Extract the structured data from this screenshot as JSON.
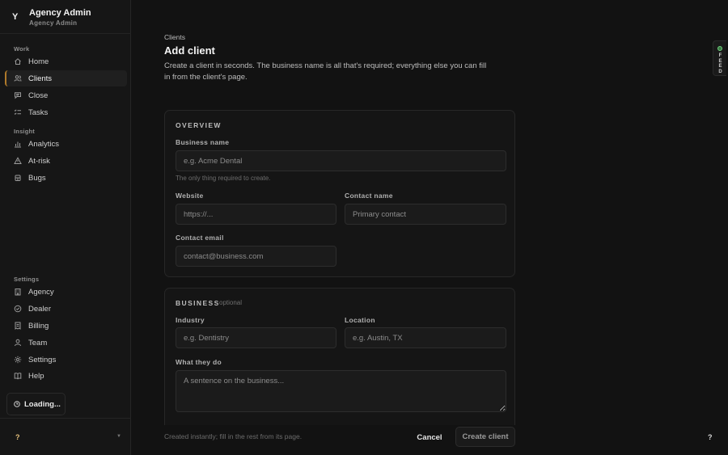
{
  "brand": {
    "logo": "Y",
    "title": "Agency Admin",
    "subtitle": "Agency Admin"
  },
  "sidebar": {
    "sections": {
      "work": "Work",
      "insight": "Insight",
      "settings": "Settings"
    },
    "work_items": [
      {
        "label": "Home",
        "icon": "home-icon"
      },
      {
        "label": "Clients",
        "icon": "users-icon",
        "active": true
      },
      {
        "label": "Close",
        "icon": "chat-icon"
      },
      {
        "label": "Tasks",
        "icon": "list-check-icon"
      }
    ],
    "insight_items": [
      {
        "label": "Analytics",
        "icon": "bar-chart-icon"
      },
      {
        "label": "At-risk",
        "icon": "warning-icon"
      },
      {
        "label": "Bugs",
        "icon": "bug-icon"
      }
    ],
    "settings_items": [
      {
        "label": "Agency",
        "icon": "building-icon"
      },
      {
        "label": "Dealer",
        "icon": "badge-icon"
      },
      {
        "label": "Billing",
        "icon": "receipt-icon"
      },
      {
        "label": "Team",
        "icon": "user-icon"
      },
      {
        "label": "Settings",
        "icon": "gear-icon"
      },
      {
        "label": "Help",
        "icon": "book-icon"
      }
    ],
    "loading_label": "Loading...",
    "help_glyph": "?",
    "chevron_glyph": "▼"
  },
  "page": {
    "breadcrumb": "Clients",
    "title": "Add client",
    "description": "Create a client in seconds. The business name is all that's required; everything else you can fill in from the client's page."
  },
  "overview": {
    "heading": "OVERVIEW",
    "business_name": {
      "label": "Business name",
      "placeholder": "e.g. Acme Dental",
      "hint": "The only thing required to create."
    },
    "website": {
      "label": "Website",
      "placeholder": "https://..."
    },
    "contact_name": {
      "label": "Contact name",
      "placeholder": "Primary contact"
    },
    "contact_email": {
      "label": "Contact email",
      "placeholder": "contact@business.com"
    }
  },
  "business": {
    "heading": "BUSINESS",
    "optional": "optional",
    "industry": {
      "label": "Industry",
      "placeholder": "e.g. Dentistry"
    },
    "location": {
      "label": "Location",
      "placeholder": "e.g. Austin, TX"
    },
    "what_they_do": {
      "label": "What they do",
      "placeholder": "A sentence on the business..."
    }
  },
  "footer": {
    "note": "Created instantly; fill in the rest from its page.",
    "cancel_label": "Cancel",
    "create_label": "Create client"
  },
  "help_fab": "?",
  "feed_tab": {
    "letters": [
      "F",
      "E",
      "E",
      "D"
    ]
  },
  "colors": {
    "background": "#121212",
    "accent": "#b07a2a",
    "feed_dot": "#6fcf7c"
  }
}
